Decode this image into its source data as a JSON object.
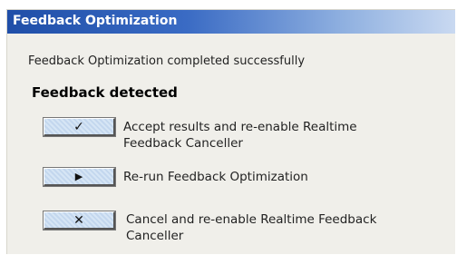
{
  "window": {
    "title": "Feedback Optimization"
  },
  "status_text": "Feedback Optimization completed successfully",
  "heading": "Feedback detected",
  "options": [
    {
      "icon": "checkmark-icon",
      "glyph": "✓",
      "label_line1": "Accept results and re-enable Realtime",
      "label_line2": "Feedback Canceller"
    },
    {
      "icon": "play-icon",
      "glyph": "▶",
      "label_line1": "Re-run Feedback Optimization",
      "label_line2": ""
    },
    {
      "icon": "close-icon",
      "glyph": "✕",
      "label_line1": "Cancel and re-enable Realtime Feedback",
      "label_line2": "Canceller"
    }
  ]
}
